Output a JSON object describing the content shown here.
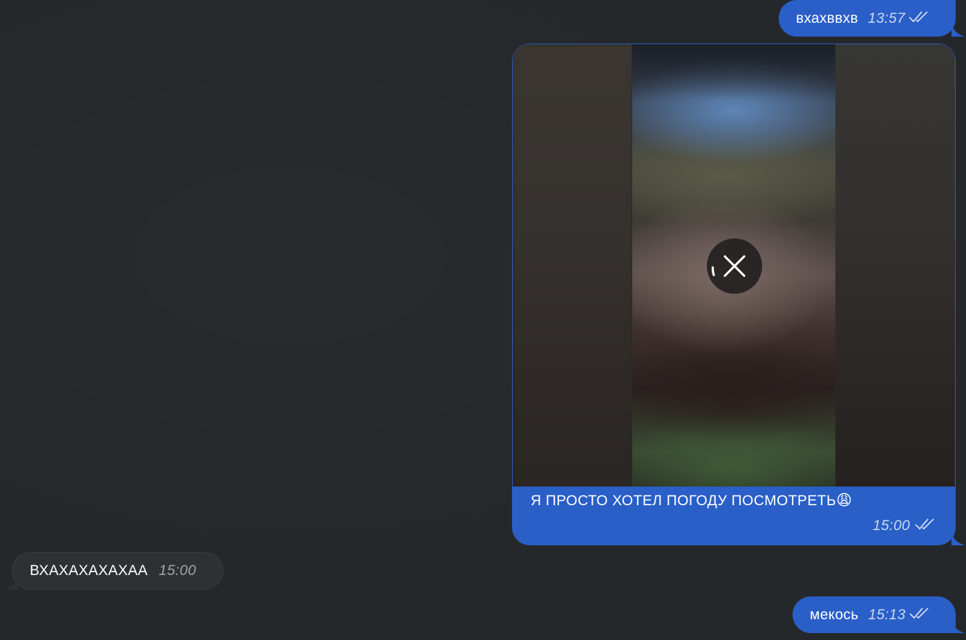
{
  "chat": {
    "messages": [
      {
        "id": "m1",
        "direction": "outgoing",
        "text": "вхахввхв",
        "time": "13:57",
        "status": "read"
      },
      {
        "id": "m3",
        "direction": "outgoing",
        "type": "video",
        "media_state": "uploading",
        "caption": "Я ПРОСТО ХОТЕЛ ПОГОДУ ПОСМОТРЕТЬ",
        "caption_emoji": "😩",
        "time": "15:00",
        "status": "read"
      },
      {
        "id": "m4",
        "direction": "incoming",
        "text": "ВХАХАХАХАХАА",
        "time": "15:00"
      },
      {
        "id": "m5",
        "direction": "outgoing",
        "text": "мекось",
        "time": "15:13",
        "status": "read"
      }
    ]
  },
  "icons": {
    "read_status": "double-check-icon",
    "cancel_upload": "close-icon"
  },
  "colors": {
    "background": "#25282b",
    "outgoing_bubble": "#2a5fc8",
    "incoming_bubble": "#2e3134"
  }
}
